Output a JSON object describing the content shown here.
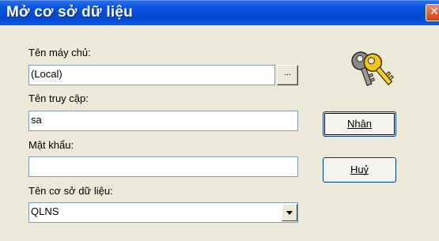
{
  "window": {
    "title": "Mở cơ sở dữ liệu",
    "close_glyph": "✕"
  },
  "form": {
    "server_label": "Tên máy chủ:",
    "server_value": "(Local)",
    "browse_label": "...",
    "login_label": "Tên truy cập:",
    "login_value": "sa",
    "password_label": "Mật khẩu:",
    "password_value": "",
    "database_label": "Tên cơ sở dữ liệu:",
    "database_value": "QLNS"
  },
  "buttons": {
    "ok_label": "Nhận",
    "cancel_label": "Huỷ"
  },
  "icons": {
    "keys": "keys-icon"
  }
}
